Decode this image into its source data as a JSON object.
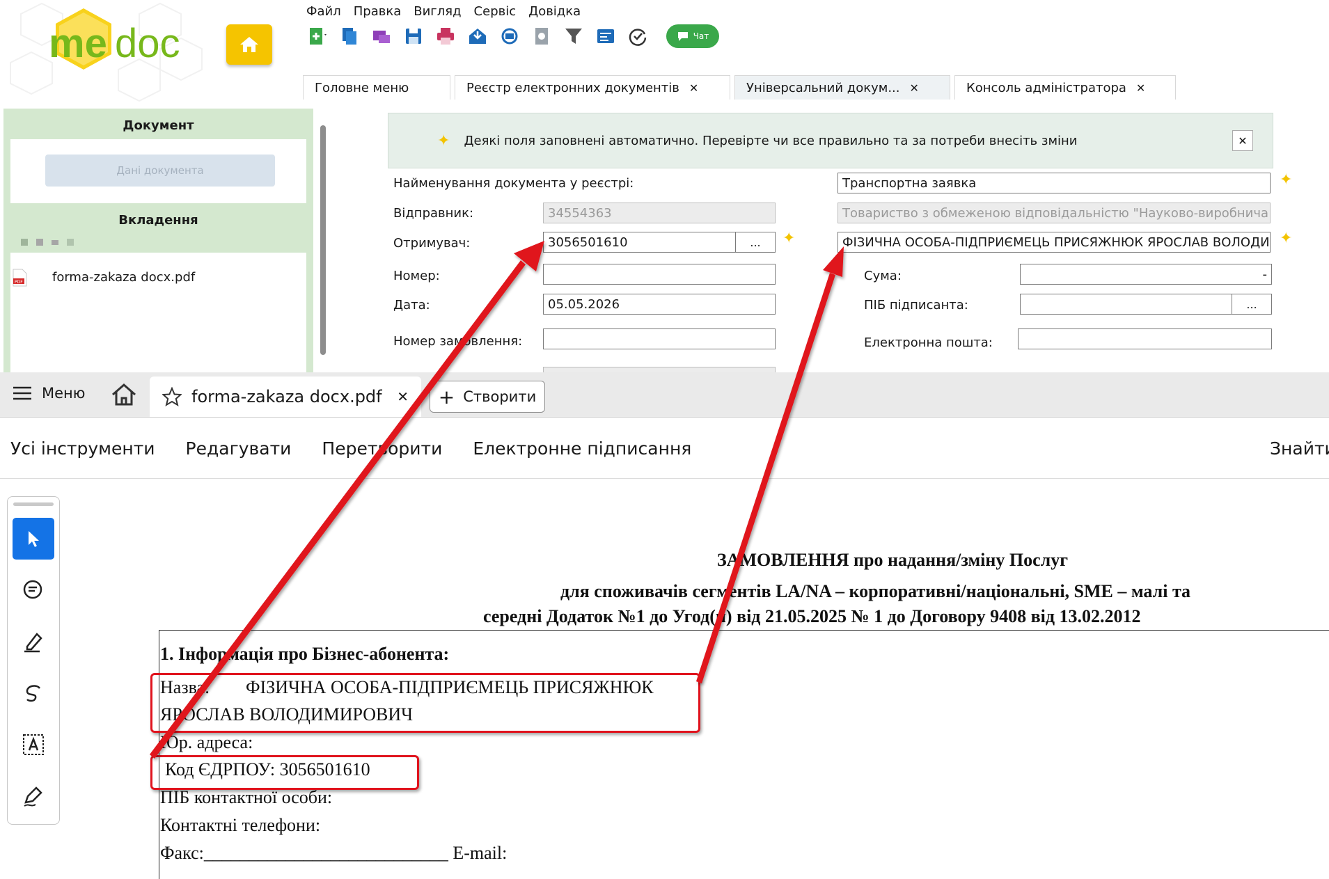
{
  "app": {
    "logo_text_me": "me",
    "logo_text_doc": "doc",
    "menu": [
      "Файл",
      "Правка",
      "Вигляд",
      "Сервіс",
      "Довідка"
    ],
    "chat_label": "Чат",
    "tabs": [
      {
        "label": "Головне меню",
        "closable": false
      },
      {
        "label": "Реєстр електронних документів",
        "closable": true
      },
      {
        "label": "Універсальний докум...",
        "closable": true
      },
      {
        "label": "Консоль адміністратора",
        "closable": true
      }
    ],
    "close_glyph": "✕"
  },
  "left_panel": {
    "document_header": "Документ",
    "document_data_button": "Дані документа",
    "attachments_header": "Вкладення",
    "file_name": "forma-zakaza docx.pdf"
  },
  "notice": {
    "text": "Деякі поля заповнені автоматично. Перевірте чи все правильно та за потреби внесіть зміни",
    "close": "✕"
  },
  "form": {
    "doc_name_label": "Найменування документа у реєстрі:",
    "doc_name_value": "Транспортна заявка",
    "sender_label": "Відправник:",
    "sender_code": "34554363",
    "sender_name": "Товариство з обмеженою відповідальністю \"Науково-виробнича к",
    "recipient_label": "Отримувач:",
    "recipient_code": "3056501610",
    "recipient_name": "ФІЗИЧНА ОСОБА-ПІДПРИЄМЕЦЬ ПРИСЯЖНЮК ЯРОСЛАВ ВОЛОДИ",
    "number_label": "Номер:",
    "number_value": "",
    "sum_label": "Сума:",
    "sum_value": "-",
    "date_label": "Дата:",
    "date_value": "05.05.2026",
    "signer_label": "ПІБ підписанта:",
    "signer_value": "",
    "order_number_label": "Номер замовлення:",
    "order_number_value": "",
    "email_label": "Електронна пошта:",
    "email_value": "",
    "dots": "..."
  },
  "acrobat": {
    "menu_label": "Меню",
    "tab_title": "forma-zakaza docx.pdf",
    "tab_close": "✕",
    "create_label": "Створити",
    "toolbar": [
      "Усі інструменти",
      "Редагувати",
      "Перетворити",
      "Електронне підписання"
    ],
    "find_label": "Знайти"
  },
  "pdf": {
    "title_line1": "ЗАМОВЛЕННЯ про надання/зміну Послуг",
    "title_line2": "для споживачів сегментів LA/NA – корпоративні/національні, SME – малі та",
    "title_line3": "середні  Додаток №1 до Угод(и) від  21.05.2025  № 1 до Договору 9408 від  13.02.2012",
    "section1": "1. Інформація про Бізнес-абонента:",
    "name_label": "Назва:",
    "name_value_line1": "ФІЗИЧНА ОСОБА-ПІДПРИЄМЕЦЬ ПРИСЯЖНЮК",
    "name_value_line2": "ЯРОСЛАВ ВОЛОДИМИРОВИЧ",
    "legal_address": "Юр. адреса:",
    "edrpou": "Код ЄДРПОУ: 3056501610",
    "contact_person": "ПІБ контактної особи:",
    "phones": "Контактні телефони:",
    "fax": "Факс:",
    "fax_line": "___________________________",
    "email": "E-mail:"
  },
  "colors": {
    "brand_yellow": "#f5c400",
    "panel_green": "#d4e8cf",
    "acro_blue": "#1473e6",
    "annotation_red": "#e0141e"
  }
}
